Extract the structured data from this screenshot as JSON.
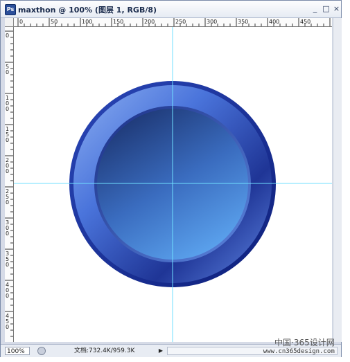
{
  "window": {
    "app_icon_label": "Ps",
    "title": "maxthon @ 100% (图层 1, RGB/8)",
    "minimize": "_",
    "restore": "□",
    "close": "×"
  },
  "rulers": {
    "top_labels": [
      "0",
      "50",
      "100",
      "150",
      "200",
      "250",
      "300",
      "350",
      "400",
      "450"
    ],
    "left_labels": [
      "0",
      "50",
      "100",
      "150",
      "200",
      "250",
      "300",
      "350",
      "400",
      "450"
    ]
  },
  "canvas": {
    "content": "blue circular button graphic with guide lines",
    "colors": {
      "outer_ring_dark": "#1a2d8a",
      "outer_ring_light": "#6f95e8",
      "inner_dark": "#1f3d7a",
      "inner_light": "#5aa2ee",
      "guide": "#6fdfff"
    }
  },
  "statusbar": {
    "zoom": "100%",
    "doc_info": "文档:732.4K/959.3K",
    "arrow": "▶"
  },
  "watermark": {
    "line1": "中国·365设计网",
    "line2": "www.cn365design.com"
  }
}
